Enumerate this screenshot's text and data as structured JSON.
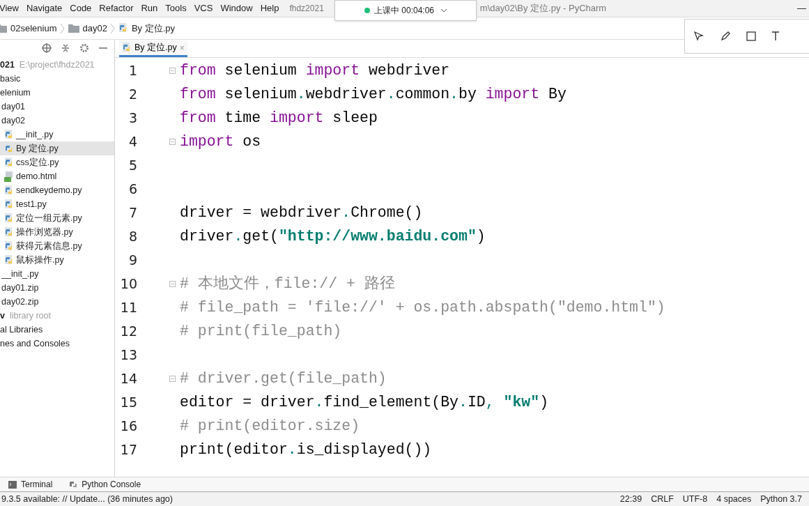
{
  "menu_bar": {
    "items": [
      "View",
      "Navigate",
      "Code",
      "Refactor",
      "Run",
      "Tools",
      "VCS",
      "Window",
      "Help"
    ],
    "title_left": "fhdz2021",
    "title_right": "m\\day02\\By 定位.py - PyCharm",
    "minimize": "—"
  },
  "class_popup": {
    "status": "上课中 00:04:06",
    "live": true
  },
  "breadcrumb": [
    "02selenium",
    "day02",
    "By 定位.py"
  ],
  "project_tree": [
    {
      "label": "021",
      "hint": "E:\\project\\fhdz2021",
      "bold": true,
      "selected": false,
      "children": [
        {
          "label": "basic",
          "selected": false
        },
        {
          "label": "elenium",
          "selected": false,
          "children": [
            {
              "label": "day01",
              "selected": false
            },
            {
              "label": "day02",
              "selected": false,
              "children": [
                {
                  "label": "__init_.py",
                  "kind": "python",
                  "selected": false
                },
                {
                  "label": "By 定位.py",
                  "kind": "python",
                  "selected": true
                },
                {
                  "label": "css定位.py",
                  "kind": "python",
                  "selected": false
                },
                {
                  "label": "demo.html",
                  "kind": "html",
                  "selected": false
                },
                {
                  "label": "sendkeydemo.py",
                  "kind": "python",
                  "selected": false
                },
                {
                  "label": "test1.py",
                  "kind": "python",
                  "selected": false
                },
                {
                  "label": "定位一组元素.py",
                  "kind": "python",
                  "selected": false
                },
                {
                  "label": "操作浏览器.py",
                  "kind": "python",
                  "selected": false
                },
                {
                  "label": "获得元素信息.py",
                  "kind": "python",
                  "selected": false
                },
                {
                  "label": "鼠标操作.py",
                  "kind": "python",
                  "selected": false
                }
              ]
            },
            {
              "label": "__init_.py",
              "selected": false
            },
            {
              "label": "day01.zip",
              "selected": false
            },
            {
              "label": "day02.zip",
              "selected": false
            }
          ]
        }
      ]
    },
    {
      "label": "v",
      "hint": "library root",
      "bold": true,
      "selected": false
    },
    {
      "label": "al Libraries",
      "selected": false
    },
    {
      "label": "nes and Consoles",
      "selected": false
    }
  ],
  "editor_tabs": [
    {
      "label": "By 定位.py",
      "close": "×",
      "selected": true
    }
  ],
  "code_lines": [
    {
      "number": "1",
      "fold": true,
      "tokens": [
        {
          "kind": "kw",
          "text": "from"
        },
        {
          "kind": "plain",
          "text": " selenium "
        },
        {
          "kind": "kw",
          "text": "import"
        },
        {
          "kind": "plain",
          "text": " webdriver"
        }
      ]
    },
    {
      "number": "2",
      "fold": false,
      "tokens": [
        {
          "kind": "kw",
          "text": "from"
        },
        {
          "kind": "plain",
          "text": " selenium"
        },
        {
          "kind": "dot",
          "text": "."
        },
        {
          "kind": "plain",
          "text": "webdriver"
        },
        {
          "kind": "dot",
          "text": "."
        },
        {
          "kind": "plain",
          "text": "common"
        },
        {
          "kind": "dot",
          "text": "."
        },
        {
          "kind": "plain",
          "text": "by "
        },
        {
          "kind": "kw",
          "text": "import"
        },
        {
          "kind": "plain",
          "text": " By"
        }
      ]
    },
    {
      "number": "3",
      "fold": false,
      "tokens": [
        {
          "kind": "kw",
          "text": "from"
        },
        {
          "kind": "plain",
          "text": " time "
        },
        {
          "kind": "kw",
          "text": "import"
        },
        {
          "kind": "plain",
          "text": " sleep"
        }
      ]
    },
    {
      "number": "4",
      "fold": true,
      "tokens": [
        {
          "kind": "kw",
          "text": "import"
        },
        {
          "kind": "plain",
          "text": " os"
        }
      ]
    },
    {
      "number": "5",
      "fold": false
    },
    {
      "number": "6",
      "fold": false
    },
    {
      "number": "7",
      "fold": false,
      "tokens": [
        {
          "kind": "plain",
          "text": "driver = webdriver"
        },
        {
          "kind": "dot",
          "text": "."
        },
        {
          "kind": "plain",
          "text": "Chrome()"
        }
      ]
    },
    {
      "number": "8",
      "fold": false,
      "tokens": [
        {
          "kind": "plain",
          "text": "driver"
        },
        {
          "kind": "dot",
          "text": "."
        },
        {
          "kind": "plain",
          "text": "get("
        },
        {
          "kind": "str",
          "text": "\"http://www.baidu.com\""
        },
        {
          "kind": "plain",
          "text": ")"
        }
      ]
    },
    {
      "number": "9",
      "fold": false
    },
    {
      "number": "10",
      "fold": true,
      "tokens": [
        {
          "kind": "cmt",
          "text": "# 本地文件，file:// + 路径"
        }
      ]
    },
    {
      "number": "11",
      "fold": false,
      "tokens": [
        {
          "kind": "cmt",
          "text": "# file_path = 'file://' + os.path.abspath(\"demo.html\")"
        }
      ]
    },
    {
      "number": "12",
      "fold": false,
      "tokens": [
        {
          "kind": "cmt",
          "text": "# print(file_path)"
        }
      ]
    },
    {
      "number": "13",
      "fold": false
    },
    {
      "number": "14",
      "fold": true,
      "tokens": [
        {
          "kind": "cmt",
          "text": "# driver.get(file_path)"
        }
      ]
    },
    {
      "number": "15",
      "fold": false,
      "tokens": [
        {
          "kind": "plain",
          "text": "editor = driver"
        },
        {
          "kind": "dot",
          "text": "."
        },
        {
          "kind": "plain",
          "text": "find_element(By"
        },
        {
          "kind": "dot",
          "text": "."
        },
        {
          "kind": "plain",
          "text": "ID"
        },
        {
          "kind": "dot",
          "text": ", "
        },
        {
          "kind": "str",
          "text": "\"kw\""
        },
        {
          "kind": "plain",
          "text": ")"
        }
      ]
    },
    {
      "number": "16",
      "fold": false,
      "tokens": [
        {
          "kind": "cmt",
          "text": "# print(editor.size)"
        }
      ]
    },
    {
      "number": "17",
      "fold": false,
      "tokens": [
        {
          "kind": "plain",
          "text": "print(editor"
        },
        {
          "kind": "dot",
          "text": "."
        },
        {
          "kind": "plain",
          "text": "is_displayed())"
        }
      ]
    }
  ],
  "tool_tabs": [
    {
      "label": "Terminal",
      "kind": "terminal"
    },
    {
      "label": "Python Console",
      "kind": "python"
    }
  ],
  "status_bar": {
    "message": "9.3.5 available: // Update... (36 minutes ago)",
    "items": [
      "22:39",
      "CRLF",
      "UTF-8",
      "4 spaces",
      "Python 3.7"
    ]
  }
}
